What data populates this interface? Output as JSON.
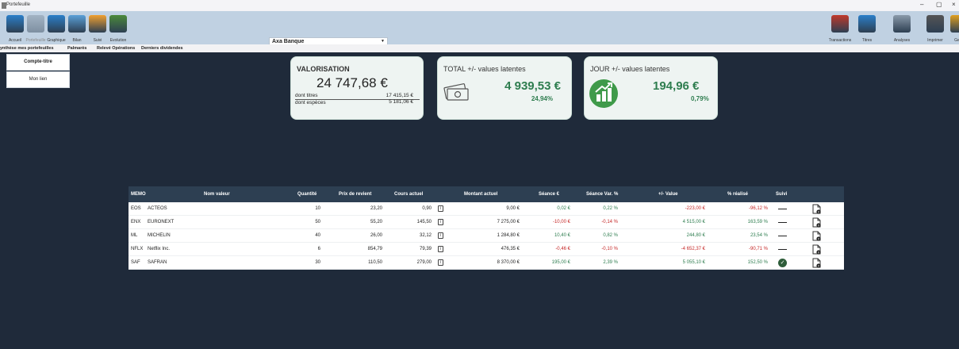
{
  "window": {
    "title": "Portefeuille",
    "controls": [
      "–",
      "▢",
      "×"
    ]
  },
  "toolbar": {
    "left": [
      {
        "label": "Accueil",
        "icon": "home-icon",
        "color": "#2b7fc9",
        "disabled": false
      },
      {
        "label": "Portefeuille",
        "icon": "wallet-icon",
        "color": "#7f8f9f",
        "disabled": true
      },
      {
        "label": "Graphique",
        "icon": "chart-icon",
        "color": "#2b7fc9",
        "disabled": false
      },
      {
        "label": "Bilan",
        "icon": "report-icon",
        "color": "#5aa0d8",
        "disabled": false
      },
      {
        "label": "Suivi",
        "icon": "folder-icon",
        "color": "#f0a030",
        "disabled": false
      },
      {
        "label": "Evolution",
        "icon": "evolution-icon",
        "color": "#4b8a3a",
        "disabled": false
      }
    ],
    "right": [
      {
        "label": "Transactions",
        "icon": "transactions-icon",
        "color": "#c0392b"
      },
      {
        "label": "Titres",
        "icon": "titles-icon",
        "color": "#2b7fc9"
      },
      {
        "label": "Analyses",
        "icon": "analysis-icon",
        "color": "#8a9aaa"
      },
      {
        "label": "Imprimer",
        "icon": "print-icon",
        "color": "#555555"
      },
      {
        "label": "Gesti",
        "icon": "manage-icon",
        "color": "#e0a020"
      }
    ],
    "bank": "Axa Banque"
  },
  "menubar": {
    "items": [
      "ynthèse mes portefeuilles",
      "Palmarès",
      "Relevé Opérations",
      "Derniers dividendes"
    ]
  },
  "leftnav": {
    "items": [
      {
        "label": "Compte-titre",
        "active": true
      },
      {
        "label": "Mon lien",
        "active": false
      }
    ]
  },
  "cards": {
    "valorisation": {
      "title": "VALORISATION",
      "value": "24 747,68 €",
      "titres_label": "dont titres",
      "titres_value": "17 415,15 €",
      "especes_label": "dont espèces",
      "especes_value": "5 181,06 €"
    },
    "total": {
      "title": "TOTAL +/- values latentes",
      "value": "4 939,53 €",
      "pct": "24,94%"
    },
    "jour": {
      "title": "JOUR +/- values latentes",
      "value": "194,96 €",
      "pct": "0,79%"
    }
  },
  "table": {
    "headers": [
      "MEMO",
      "Nom valeur",
      "Quantité",
      "Prix de revient",
      "Cours actuel",
      "Montant actuel",
      "Séance €",
      "Séance Var. %",
      "+/- Value",
      "% réalisé",
      "Suivi"
    ],
    "rows": [
      {
        "memo": "EOS",
        "nom": "ACTEOS",
        "qte": "10",
        "prix": "23,20",
        "cours": "0,90",
        "montant": "9,00 €",
        "seance": "0,02 €",
        "seance_sign": "pos",
        "var": "0,22 %",
        "var_sign": "pos",
        "pv": "-223,00 €",
        "pv_sign": "neg",
        "real": "-96,12 %",
        "real_sign": "neg",
        "suivi": "dash"
      },
      {
        "memo": "ENX",
        "nom": "EURONEXT",
        "qte": "50",
        "prix": "55,20",
        "cours": "145,50",
        "montant": "7 275,00 €",
        "seance": "-10,00 €",
        "seance_sign": "neg",
        "var": "-0,14 %",
        "var_sign": "neg",
        "pv": "4 515,00 €",
        "pv_sign": "pos",
        "real": "163,59 %",
        "real_sign": "pos",
        "suivi": "dash"
      },
      {
        "memo": "ML",
        "nom": "MICHELIN",
        "qte": "40",
        "prix": "26,00",
        "cours": "32,12",
        "montant": "1 284,80 €",
        "seance": "10,40 €",
        "seance_sign": "pos",
        "var": "0,82 %",
        "var_sign": "pos",
        "pv": "244,80 €",
        "pv_sign": "pos",
        "real": "23,54 %",
        "real_sign": "pos",
        "suivi": "dash"
      },
      {
        "memo": "NFLX",
        "nom": "Netflix Inc.",
        "qte": "6",
        "prix": "854,79",
        "cours": "79,39",
        "montant": "476,35 €",
        "seance": "-0,46 €",
        "seance_sign": "neg",
        "var": "-0,10 %",
        "var_sign": "neg",
        "pv": "-4 652,37 €",
        "pv_sign": "neg",
        "real": "-90,71 %",
        "real_sign": "neg",
        "suivi": "dash"
      },
      {
        "memo": "SAF",
        "nom": "SAFRAN",
        "qte": "30",
        "prix": "110,50",
        "cours": "279,00",
        "montant": "8 370,00 €",
        "seance": "195,00 €",
        "seance_sign": "pos",
        "var": "2,39 %",
        "var_sign": "pos",
        "pv": "5 055,10 €",
        "pv_sign": "pos",
        "real": "152,50 %",
        "real_sign": "pos",
        "suivi": "check"
      }
    ]
  },
  "colors": {
    "positive": "#2e7d4f",
    "negative": "#c62828",
    "background": "#1f2a3a",
    "toolbar": "#c0d1e2"
  }
}
